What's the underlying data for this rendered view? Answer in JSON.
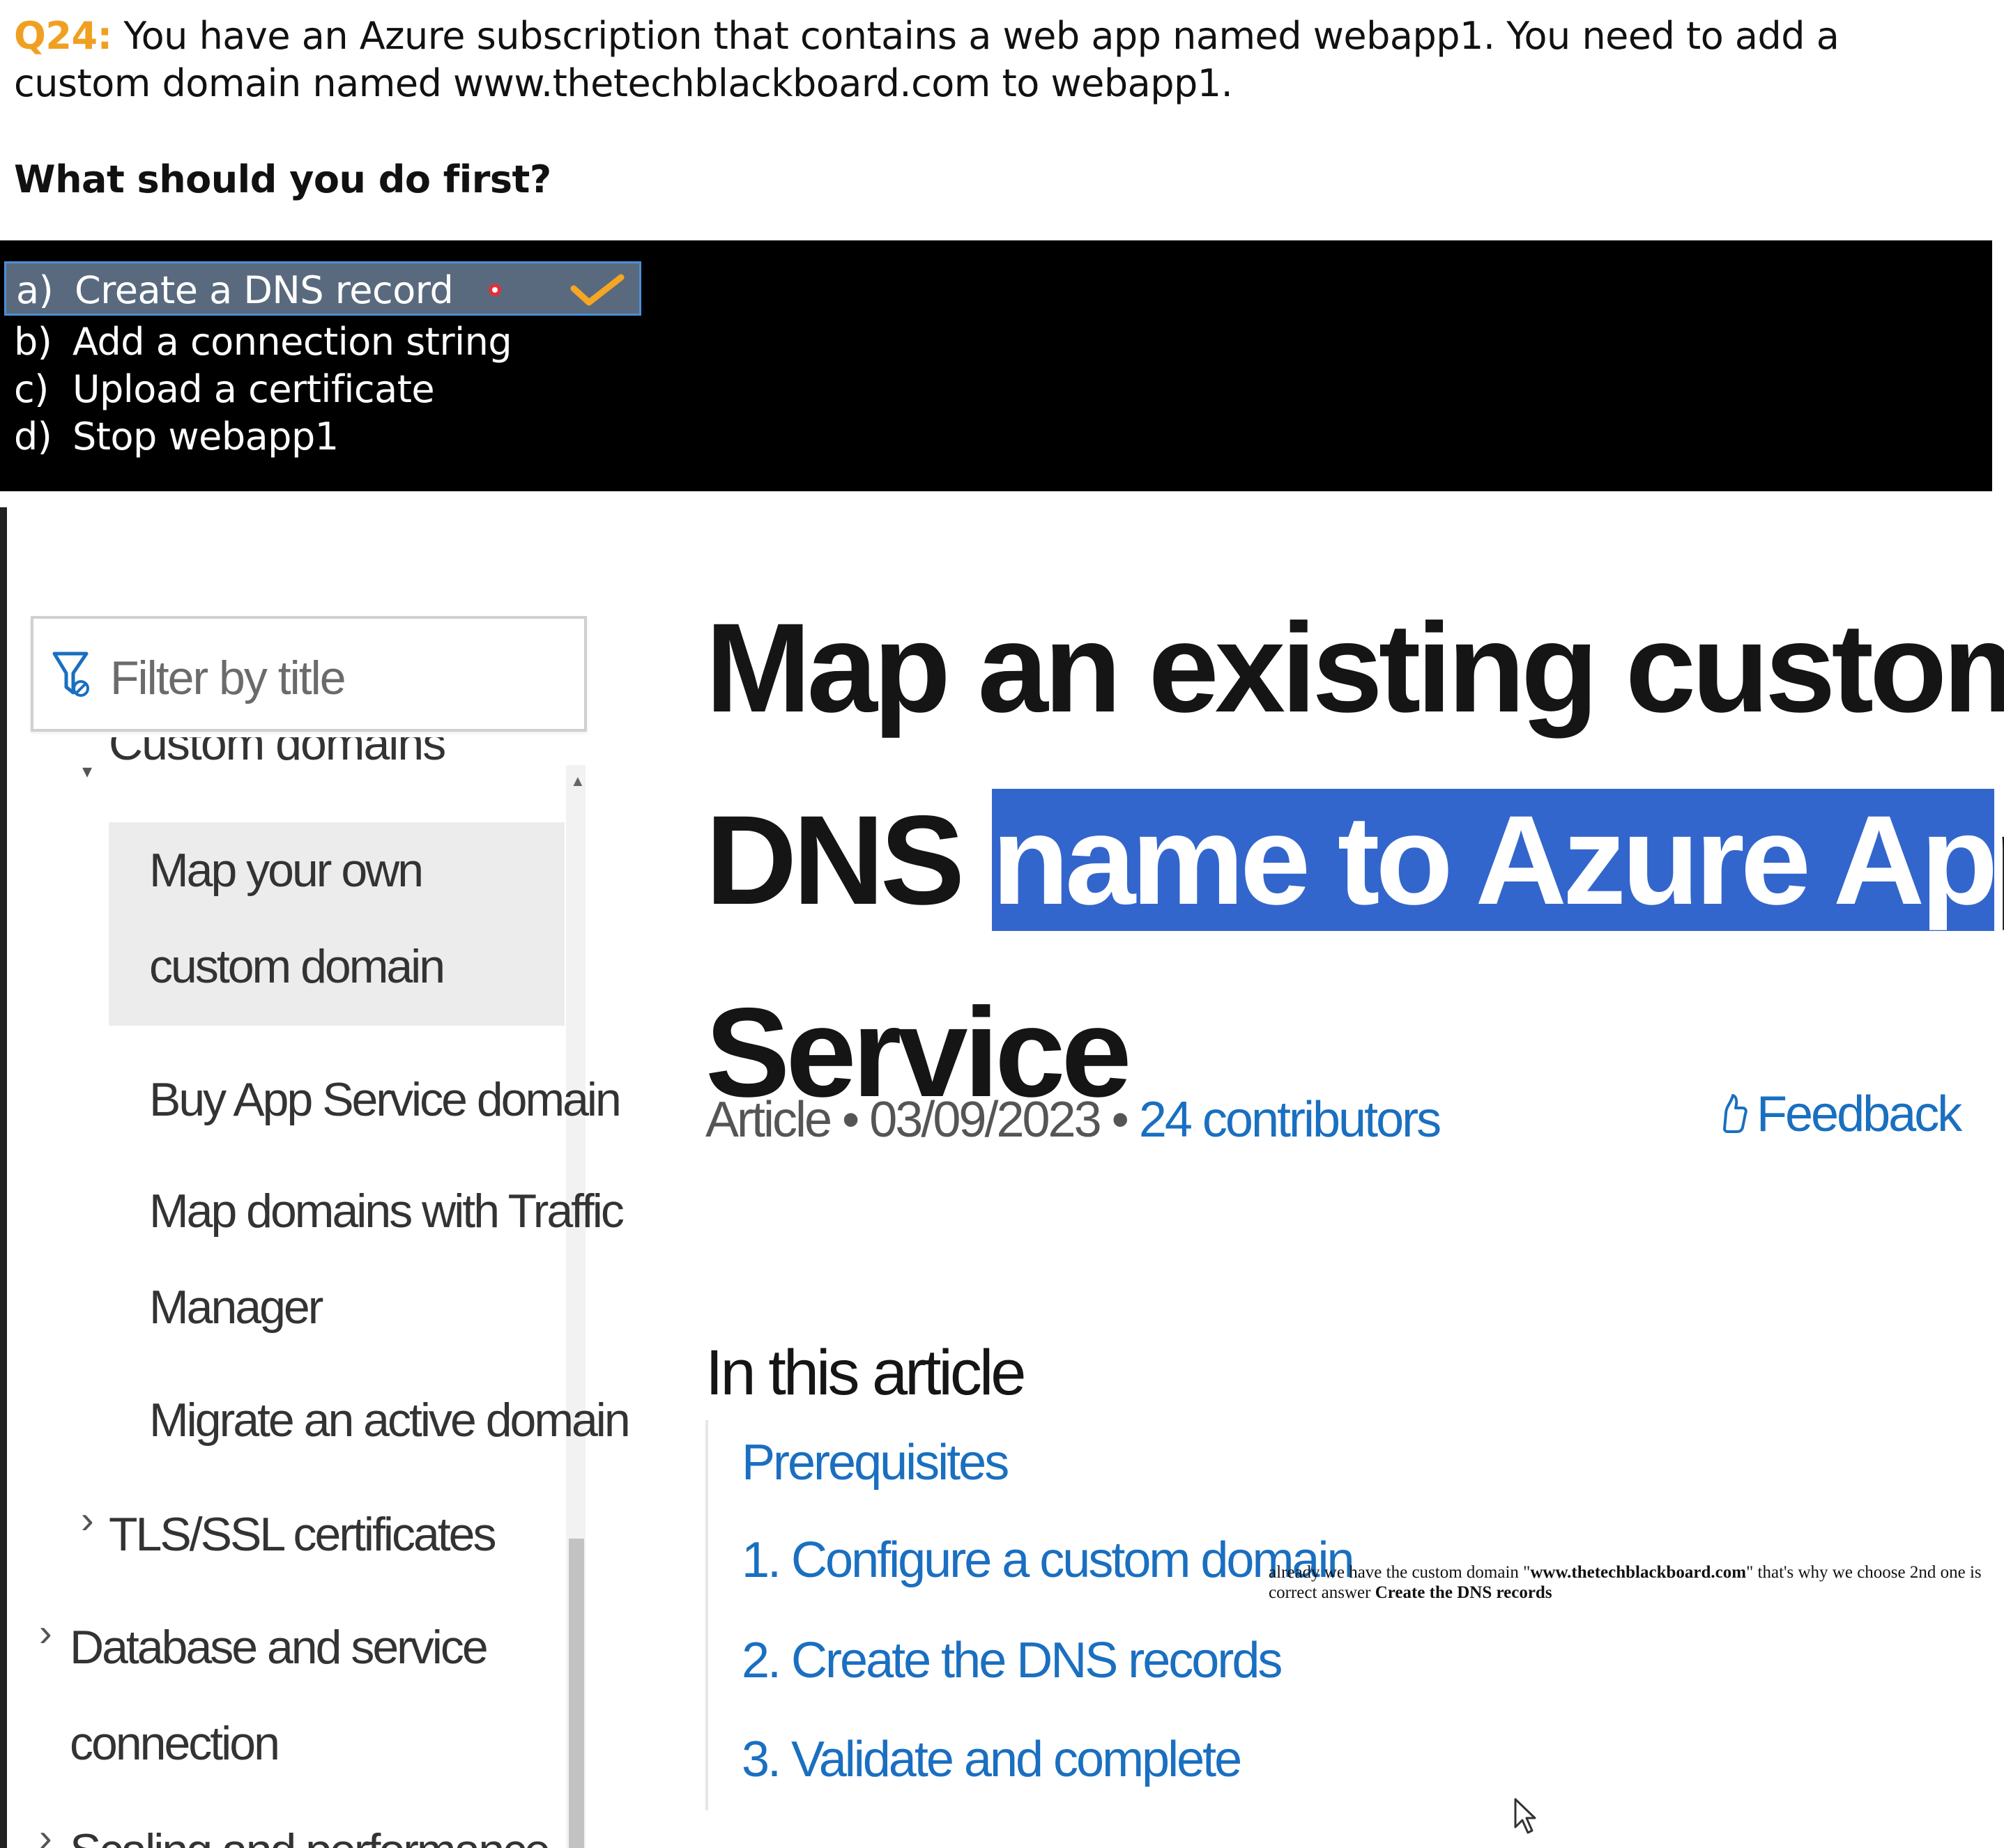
{
  "question": {
    "number": "Q24:",
    "text": " You have an Azure subscription that contains a web app named webapp1. You need to add a custom domain named www.thetechblackboard.com to webapp1.",
    "prompt": "What should you do first?",
    "options": [
      {
        "letter": "a)",
        "label": "Create a DNS record",
        "selected": true
      },
      {
        "letter": "b)",
        "label": "Add a connection string"
      },
      {
        "letter": "c)",
        "label": "Upload a certificate"
      },
      {
        "letter": "d)",
        "label": "Stop webapp1"
      }
    ],
    "colors": {
      "number": "#f0a021",
      "options_bg": "#000000",
      "selected_bg": "#5a6a7e",
      "check": "#f5a623"
    }
  },
  "docs": {
    "filter_placeholder": "Filter by title",
    "nav_cutoff": "Custom domains",
    "nav": [
      {
        "label": "Map your own custom domain"
      },
      {
        "label": "Buy App Service domain"
      },
      {
        "label": "Map domains with Traffic"
      },
      {
        "label": "Manager"
      },
      {
        "label": "Migrate an active domain"
      },
      {
        "label": "TLS/SSL certificates"
      },
      {
        "label": "Database and service"
      },
      {
        "label": "connection"
      },
      {
        "label": "Scaling and performance"
      }
    ],
    "title": {
      "line1": "Map an existing custom",
      "line2_pre": "DNS ",
      "line2_hl": "name to Azure Ap",
      "line2_post": "p",
      "line3": "Service"
    },
    "meta": {
      "type": "Article",
      "sep": " • ",
      "date": "03/09/2023",
      "contributors": "24 contributors"
    },
    "feedback": "Feedback",
    "toc_title": "In this article",
    "toc": [
      "Prerequisites",
      "1. Configure a custom domain",
      "2. Create the DNS records",
      "3. Validate and complete"
    ],
    "colors": {
      "link": "#1a6fc0",
      "highlight": "#3366cc"
    }
  },
  "note": {
    "pre": "already we have the custom domain \"",
    "domain": "www.thetechblackboard.com",
    "mid": "\" that's why we choose 2nd one is correct answer ",
    "answer": "Create the DNS records"
  }
}
